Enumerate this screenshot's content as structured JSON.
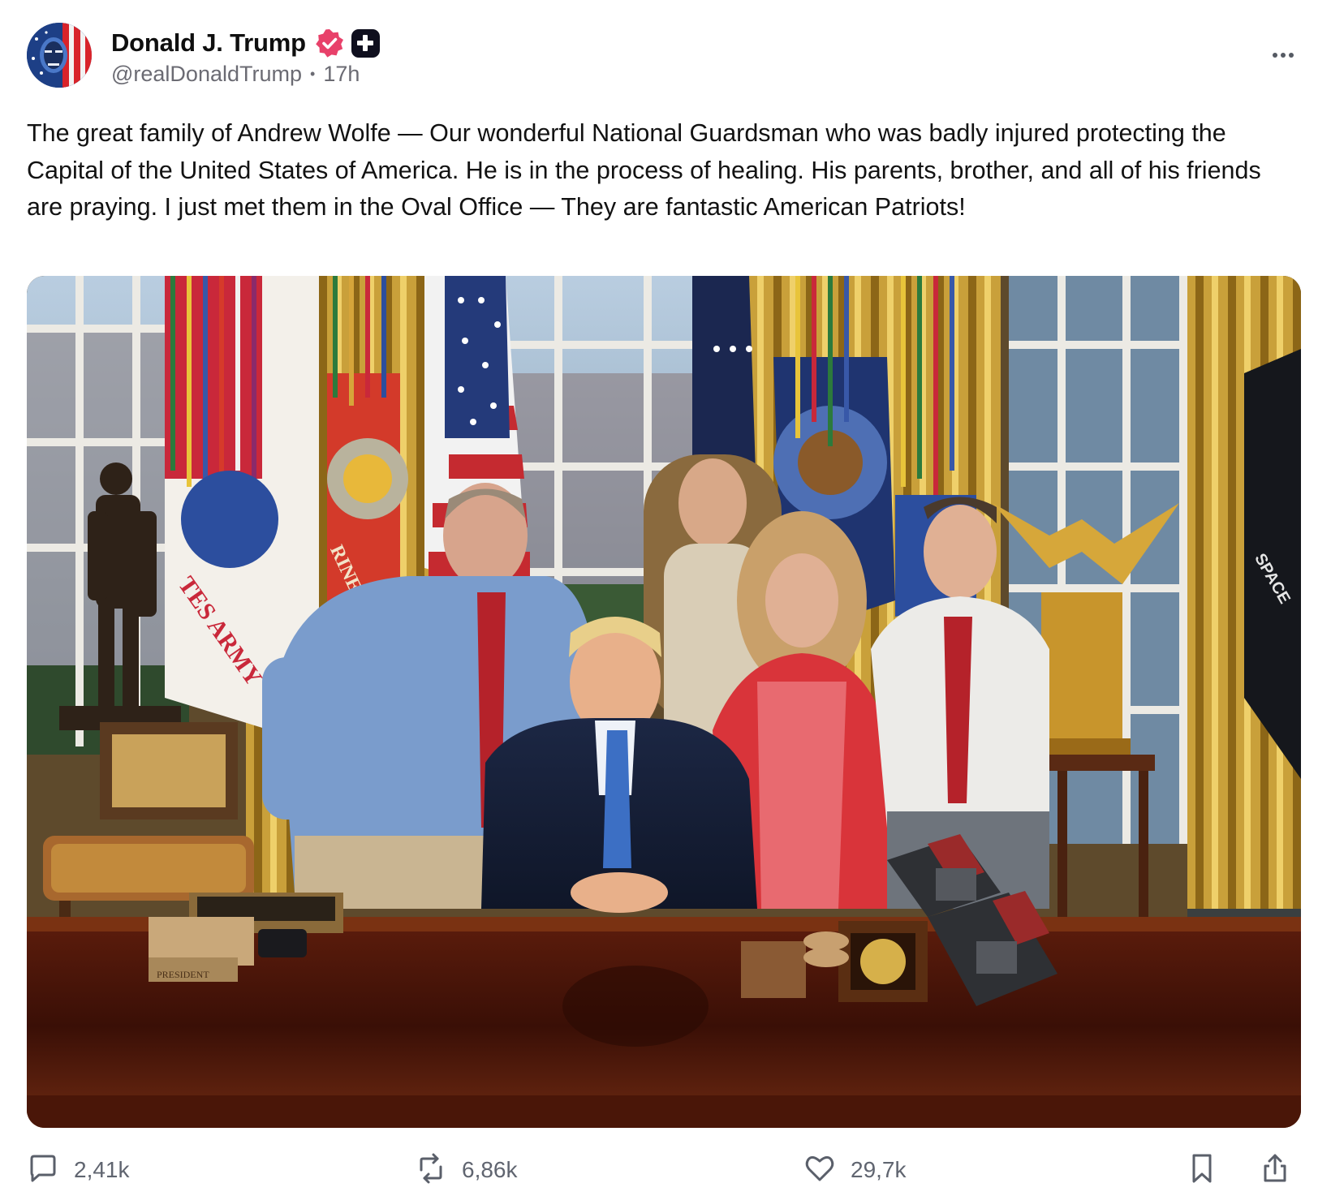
{
  "post": {
    "author": {
      "display_name": "Donald J. Trump",
      "handle": "@realDonaldTrump",
      "time_ago": "17h",
      "meta_separator": "•"
    },
    "text": "The great family of Andrew Wolfe — Our wonderful National Guardsman who was badly injured protecting the Capital of the United States of America. He is in the process of healing. His parents, brother, and all of his friends are praying. I just met them in the Oval Office — They are fantastic American Patriots!",
    "media": {
      "flag_text_left": "TES ARMY",
      "flag_text_marine": "RINE",
      "flag_text_space": "SPACE",
      "desk_plaque": "PRESIDENT"
    },
    "actions": {
      "replies": "2,41k",
      "reposts": "6,86k",
      "likes": "29,7k"
    }
  },
  "colors": {
    "verified_badge": "#e8416a",
    "plus_badge": "#0f0f1e",
    "meta_text": "#6b6b73",
    "action_icon": "#5a5f6a"
  },
  "icons": [
    "verified-icon",
    "plus-badge-icon",
    "more-icon",
    "reply-icon",
    "repost-icon",
    "like-icon",
    "bookmark-icon",
    "share-icon"
  ]
}
